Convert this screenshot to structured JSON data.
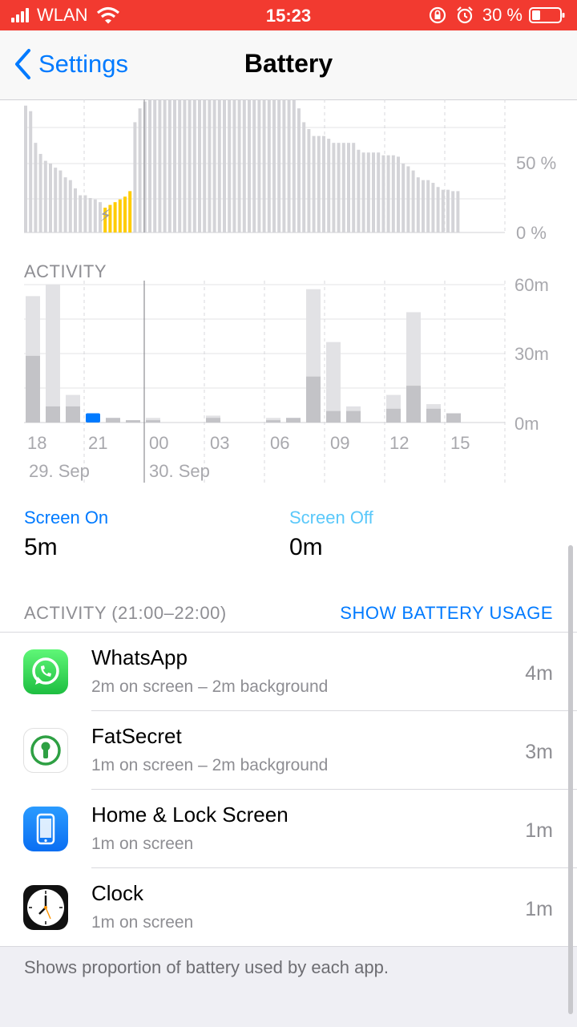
{
  "status_bar": {
    "carrier": "WLAN",
    "time": "15:23",
    "battery": "30 %"
  },
  "nav": {
    "back_label": "Settings",
    "title": "Battery"
  },
  "battery_chart": {
    "y_ticks": [
      "50 %",
      "0 %"
    ]
  },
  "activity_chart": {
    "section_label": "ACTIVITY",
    "y_ticks": [
      "60m",
      "30m",
      "0m"
    ],
    "x_ticks": [
      "18",
      "21",
      "00",
      "03",
      "06",
      "09",
      "12",
      "15"
    ],
    "date_labels": [
      "29. Sep",
      "30. Sep"
    ]
  },
  "chart_data": [
    {
      "type": "bar",
      "title": "",
      "ylim": [
        0,
        100
      ],
      "y_unit": "%",
      "x_ticks": [],
      "note_levels": "battery level per interval",
      "values": [
        92,
        88,
        65,
        57,
        52,
        50,
        47,
        45,
        40,
        38,
        32,
        27,
        27,
        25,
        24,
        22,
        18,
        20,
        22,
        24,
        26,
        30,
        80,
        90,
        95,
        98,
        100,
        100,
        100,
        100,
        100,
        100,
        100,
        100,
        100,
        100,
        100,
        100,
        100,
        100,
        100,
        100,
        100,
        100,
        100,
        100,
        100,
        100,
        100,
        100,
        100,
        100,
        100,
        100,
        100,
        90,
        80,
        75,
        70,
        70,
        70,
        68,
        65,
        65,
        65,
        65,
        65,
        60,
        58,
        58,
        58,
        58,
        56,
        56,
        56,
        55,
        50,
        48,
        45,
        40,
        38,
        38,
        36,
        33,
        31,
        31,
        30,
        30
      ],
      "charging_yellow_from": 16,
      "charging_yellow_to": 22
    },
    {
      "type": "bar",
      "title": "",
      "ylim": [
        0,
        60
      ],
      "y_unit": "m",
      "categories": [
        "18",
        "19",
        "20",
        "21",
        "22",
        "23",
        "00",
        "01",
        "02",
        "03",
        "04",
        "05",
        "06",
        "07",
        "08",
        "09",
        "10",
        "11",
        "12",
        "13",
        "14",
        "15"
      ],
      "series": [
        {
          "values": [
            29,
            7,
            7,
            4,
            2,
            1,
            1,
            0,
            0,
            2,
            0,
            0,
            1,
            2,
            20,
            5,
            5,
            0,
            6,
            16,
            6,
            4
          ]
        },
        {
          "values": [
            55,
            60,
            12,
            0,
            2,
            1,
            2,
            0,
            0,
            3,
            0,
            0,
            2,
            2,
            58,
            35,
            7,
            0,
            12,
            48,
            8,
            4
          ]
        }
      ]
    }
  ],
  "usage_stats": {
    "screen_on_label": "Screen On",
    "screen_on_value": "5m",
    "screen_off_label": "Screen Off",
    "screen_off_value": "0m"
  },
  "activity_list": {
    "header": "ACTIVITY (21:00–22:00)",
    "action": "SHOW BATTERY USAGE",
    "apps": [
      {
        "name": "WhatsApp",
        "detail": "2m on screen – 2m background",
        "time": "4m"
      },
      {
        "name": "FatSecret",
        "detail": "1m on screen – 2m background",
        "time": "3m"
      },
      {
        "name": "Home & Lock Screen",
        "detail": "1m on screen",
        "time": "1m"
      },
      {
        "name": "Clock",
        "detail": "1m on screen",
        "time": "1m"
      }
    ]
  },
  "footer_text": "Shows proportion of battery used by each app.",
  "colors": {
    "accent": "#007aff",
    "status_bar": "#f23a30",
    "charging": "#ffcc00",
    "whatsapp": "#25d366",
    "home": "#1a82fb"
  }
}
